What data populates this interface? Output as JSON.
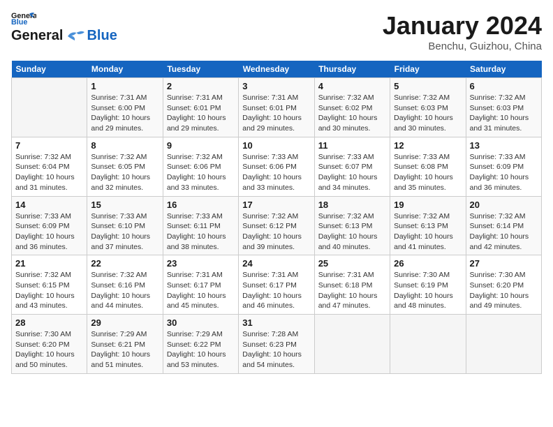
{
  "header": {
    "logo_line1": "General",
    "logo_line2": "Blue",
    "month": "January 2024",
    "location": "Benchu, Guizhou, China"
  },
  "weekdays": [
    "Sunday",
    "Monday",
    "Tuesday",
    "Wednesday",
    "Thursday",
    "Friday",
    "Saturday"
  ],
  "weeks": [
    [
      {
        "day": "",
        "info": ""
      },
      {
        "day": "1",
        "info": "Sunrise: 7:31 AM\nSunset: 6:00 PM\nDaylight: 10 hours\nand 29 minutes."
      },
      {
        "day": "2",
        "info": "Sunrise: 7:31 AM\nSunset: 6:01 PM\nDaylight: 10 hours\nand 29 minutes."
      },
      {
        "day": "3",
        "info": "Sunrise: 7:31 AM\nSunset: 6:01 PM\nDaylight: 10 hours\nand 29 minutes."
      },
      {
        "day": "4",
        "info": "Sunrise: 7:32 AM\nSunset: 6:02 PM\nDaylight: 10 hours\nand 30 minutes."
      },
      {
        "day": "5",
        "info": "Sunrise: 7:32 AM\nSunset: 6:03 PM\nDaylight: 10 hours\nand 30 minutes."
      },
      {
        "day": "6",
        "info": "Sunrise: 7:32 AM\nSunset: 6:03 PM\nDaylight: 10 hours\nand 31 minutes."
      }
    ],
    [
      {
        "day": "7",
        "info": "Sunrise: 7:32 AM\nSunset: 6:04 PM\nDaylight: 10 hours\nand 31 minutes."
      },
      {
        "day": "8",
        "info": "Sunrise: 7:32 AM\nSunset: 6:05 PM\nDaylight: 10 hours\nand 32 minutes."
      },
      {
        "day": "9",
        "info": "Sunrise: 7:32 AM\nSunset: 6:06 PM\nDaylight: 10 hours\nand 33 minutes."
      },
      {
        "day": "10",
        "info": "Sunrise: 7:33 AM\nSunset: 6:06 PM\nDaylight: 10 hours\nand 33 minutes."
      },
      {
        "day": "11",
        "info": "Sunrise: 7:33 AM\nSunset: 6:07 PM\nDaylight: 10 hours\nand 34 minutes."
      },
      {
        "day": "12",
        "info": "Sunrise: 7:33 AM\nSunset: 6:08 PM\nDaylight: 10 hours\nand 35 minutes."
      },
      {
        "day": "13",
        "info": "Sunrise: 7:33 AM\nSunset: 6:09 PM\nDaylight: 10 hours\nand 36 minutes."
      }
    ],
    [
      {
        "day": "14",
        "info": "Sunrise: 7:33 AM\nSunset: 6:09 PM\nDaylight: 10 hours\nand 36 minutes."
      },
      {
        "day": "15",
        "info": "Sunrise: 7:33 AM\nSunset: 6:10 PM\nDaylight: 10 hours\nand 37 minutes."
      },
      {
        "day": "16",
        "info": "Sunrise: 7:33 AM\nSunset: 6:11 PM\nDaylight: 10 hours\nand 38 minutes."
      },
      {
        "day": "17",
        "info": "Sunrise: 7:32 AM\nSunset: 6:12 PM\nDaylight: 10 hours\nand 39 minutes."
      },
      {
        "day": "18",
        "info": "Sunrise: 7:32 AM\nSunset: 6:13 PM\nDaylight: 10 hours\nand 40 minutes."
      },
      {
        "day": "19",
        "info": "Sunrise: 7:32 AM\nSunset: 6:13 PM\nDaylight: 10 hours\nand 41 minutes."
      },
      {
        "day": "20",
        "info": "Sunrise: 7:32 AM\nSunset: 6:14 PM\nDaylight: 10 hours\nand 42 minutes."
      }
    ],
    [
      {
        "day": "21",
        "info": "Sunrise: 7:32 AM\nSunset: 6:15 PM\nDaylight: 10 hours\nand 43 minutes."
      },
      {
        "day": "22",
        "info": "Sunrise: 7:32 AM\nSunset: 6:16 PM\nDaylight: 10 hours\nand 44 minutes."
      },
      {
        "day": "23",
        "info": "Sunrise: 7:31 AM\nSunset: 6:17 PM\nDaylight: 10 hours\nand 45 minutes."
      },
      {
        "day": "24",
        "info": "Sunrise: 7:31 AM\nSunset: 6:17 PM\nDaylight: 10 hours\nand 46 minutes."
      },
      {
        "day": "25",
        "info": "Sunrise: 7:31 AM\nSunset: 6:18 PM\nDaylight: 10 hours\nand 47 minutes."
      },
      {
        "day": "26",
        "info": "Sunrise: 7:30 AM\nSunset: 6:19 PM\nDaylight: 10 hours\nand 48 minutes."
      },
      {
        "day": "27",
        "info": "Sunrise: 7:30 AM\nSunset: 6:20 PM\nDaylight: 10 hours\nand 49 minutes."
      }
    ],
    [
      {
        "day": "28",
        "info": "Sunrise: 7:30 AM\nSunset: 6:20 PM\nDaylight: 10 hours\nand 50 minutes."
      },
      {
        "day": "29",
        "info": "Sunrise: 7:29 AM\nSunset: 6:21 PM\nDaylight: 10 hours\nand 51 minutes."
      },
      {
        "day": "30",
        "info": "Sunrise: 7:29 AM\nSunset: 6:22 PM\nDaylight: 10 hours\nand 53 minutes."
      },
      {
        "day": "31",
        "info": "Sunrise: 7:28 AM\nSunset: 6:23 PM\nDaylight: 10 hours\nand 54 minutes."
      },
      {
        "day": "",
        "info": ""
      },
      {
        "day": "",
        "info": ""
      },
      {
        "day": "",
        "info": ""
      }
    ]
  ]
}
